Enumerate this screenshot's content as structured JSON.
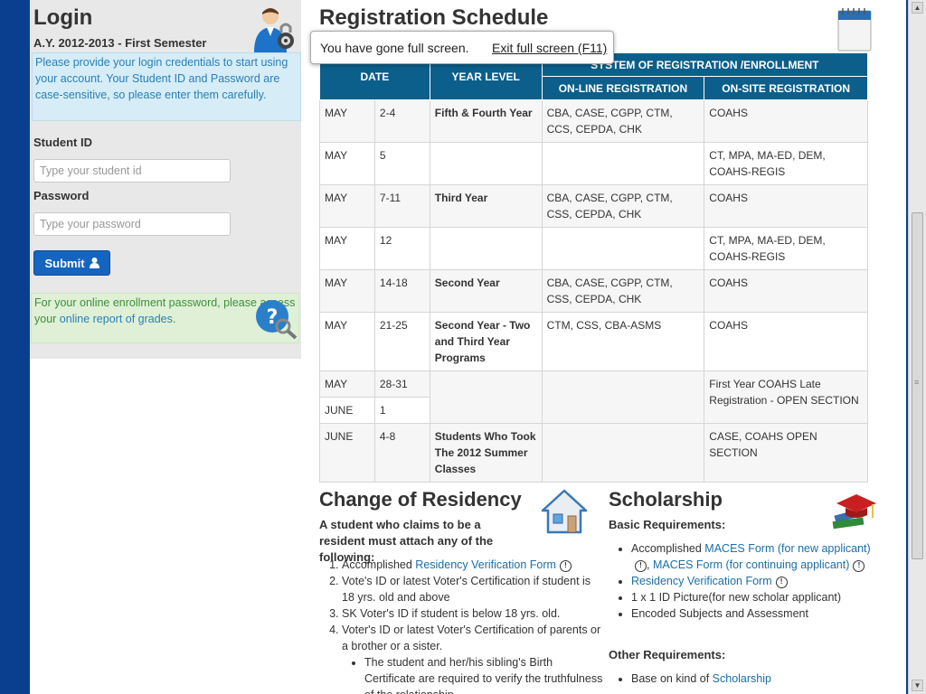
{
  "login": {
    "title": "Login",
    "semester": "A.Y. 2012-2013 - First Semester",
    "info": "Please provide your login credentials to start using your account. Your Student ID and Password are case-sensitive, so please enter them carefully.",
    "student_id_label": "Student ID",
    "student_id_placeholder": "Type your student id",
    "password_label": "Password",
    "password_placeholder": "Type your password",
    "submit_label": "Submit",
    "enroll_text": "For your online enrollment password, please access your ",
    "enroll_link": "online report of grades",
    "enroll_end": "."
  },
  "fullscreen": {
    "message": "You have gone full screen.",
    "exit_label": "Exit full screen (F11)"
  },
  "schedule": {
    "title": "Registration Schedule",
    "header_group": "SYSTEM OF REGISTRATION /ENROLLMENT",
    "col_date": "DATE",
    "col_year": "YEAR LEVEL",
    "col_online": "ON-LINE REGISTRATION",
    "col_onsite": "ON-SITE REGISTRATION",
    "rows": [
      {
        "month": "MAY",
        "days": "2-4",
        "year": "Fifth & Fourth Year",
        "online": "CBA, CASE, CGPP, CTM, CCS, CEPDA, CHK",
        "onsite": "COAHS"
      },
      {
        "month": "MAY",
        "days": "5",
        "year": "",
        "online": "",
        "onsite": "CT, MPA, MA-ED, DEM, COAHS-REGIS"
      },
      {
        "month": "MAY",
        "days": "7-11",
        "year": "Third Year",
        "online": "CBA, CASE, CGPP, CTM, CSS, CEPDA, CHK",
        "onsite": "COAHS"
      },
      {
        "month": "MAY",
        "days": "12",
        "year": "",
        "online": "",
        "onsite": "CT, MPA, MA-ED, DEM, COAHS-REGIS"
      },
      {
        "month": "MAY",
        "days": "14-18",
        "year": "Second Year",
        "online": "CBA, CASE, CGPP, CTM, CSS, CEPDA, CHK",
        "onsite": "COAHS"
      },
      {
        "month": "MAY",
        "days": "21-25",
        "year": "Second Year - Two and Third Year Programs",
        "online": "CTM, CSS, CBA-ASMS",
        "onsite": "COAHS"
      }
    ],
    "late": {
      "month1": "MAY",
      "days1": "28-31",
      "month2": "JUNE",
      "days2": "1",
      "onsite": "First Year COAHS Late Registration - OPEN SECTION"
    },
    "last": {
      "month": "JUNE",
      "days": "4-8",
      "year": "Students Who Took The 2012 Summer Classes",
      "online": "",
      "onsite": "CASE, COAHS OPEN SECTION"
    }
  },
  "residency": {
    "title": "Change of Residency",
    "intro": "A student who claims to be a resident must attach any of the following:",
    "item1_pre": "Accomplished ",
    "item1_link": "Residency Verification Form",
    "item2": "Vote's ID or latest Voter's Certification if student is 18 yrs. old and above",
    "item3": "SK Voter's ID if student is below 18 yrs. old.",
    "item4": "Voter's ID or latest Voter's Certification of parents or a brother or a sister.",
    "sub1": "The student and her/his sibling's Birth Certificate are required to verify the truthfulness of the relationship."
  },
  "scholarship": {
    "title": "Scholarship",
    "basic": "Basic Requirements:",
    "b1_pre": "Accomplished ",
    "b1_link1": "MACES Form (for new applicant)",
    "b1_sep": ", ",
    "b1_link2": "MACES Form (for continuing applicant)",
    "b2_link": "Residency Verification Form",
    "b3": "1 x 1 ID Picture(for new scholar applicant)",
    "b4": "Encoded Subjects and Assessment",
    "other": "Other Requirements:",
    "o1_pre": "Base on kind of ",
    "o1_link": "Scholarship"
  },
  "colors": {
    "table_header": "#0b5f8a",
    "brand_blue": "#0a3f8f",
    "submit": "#1565c0",
    "info_box": "#d6ecf6",
    "enroll_box": "#dff0d6"
  }
}
